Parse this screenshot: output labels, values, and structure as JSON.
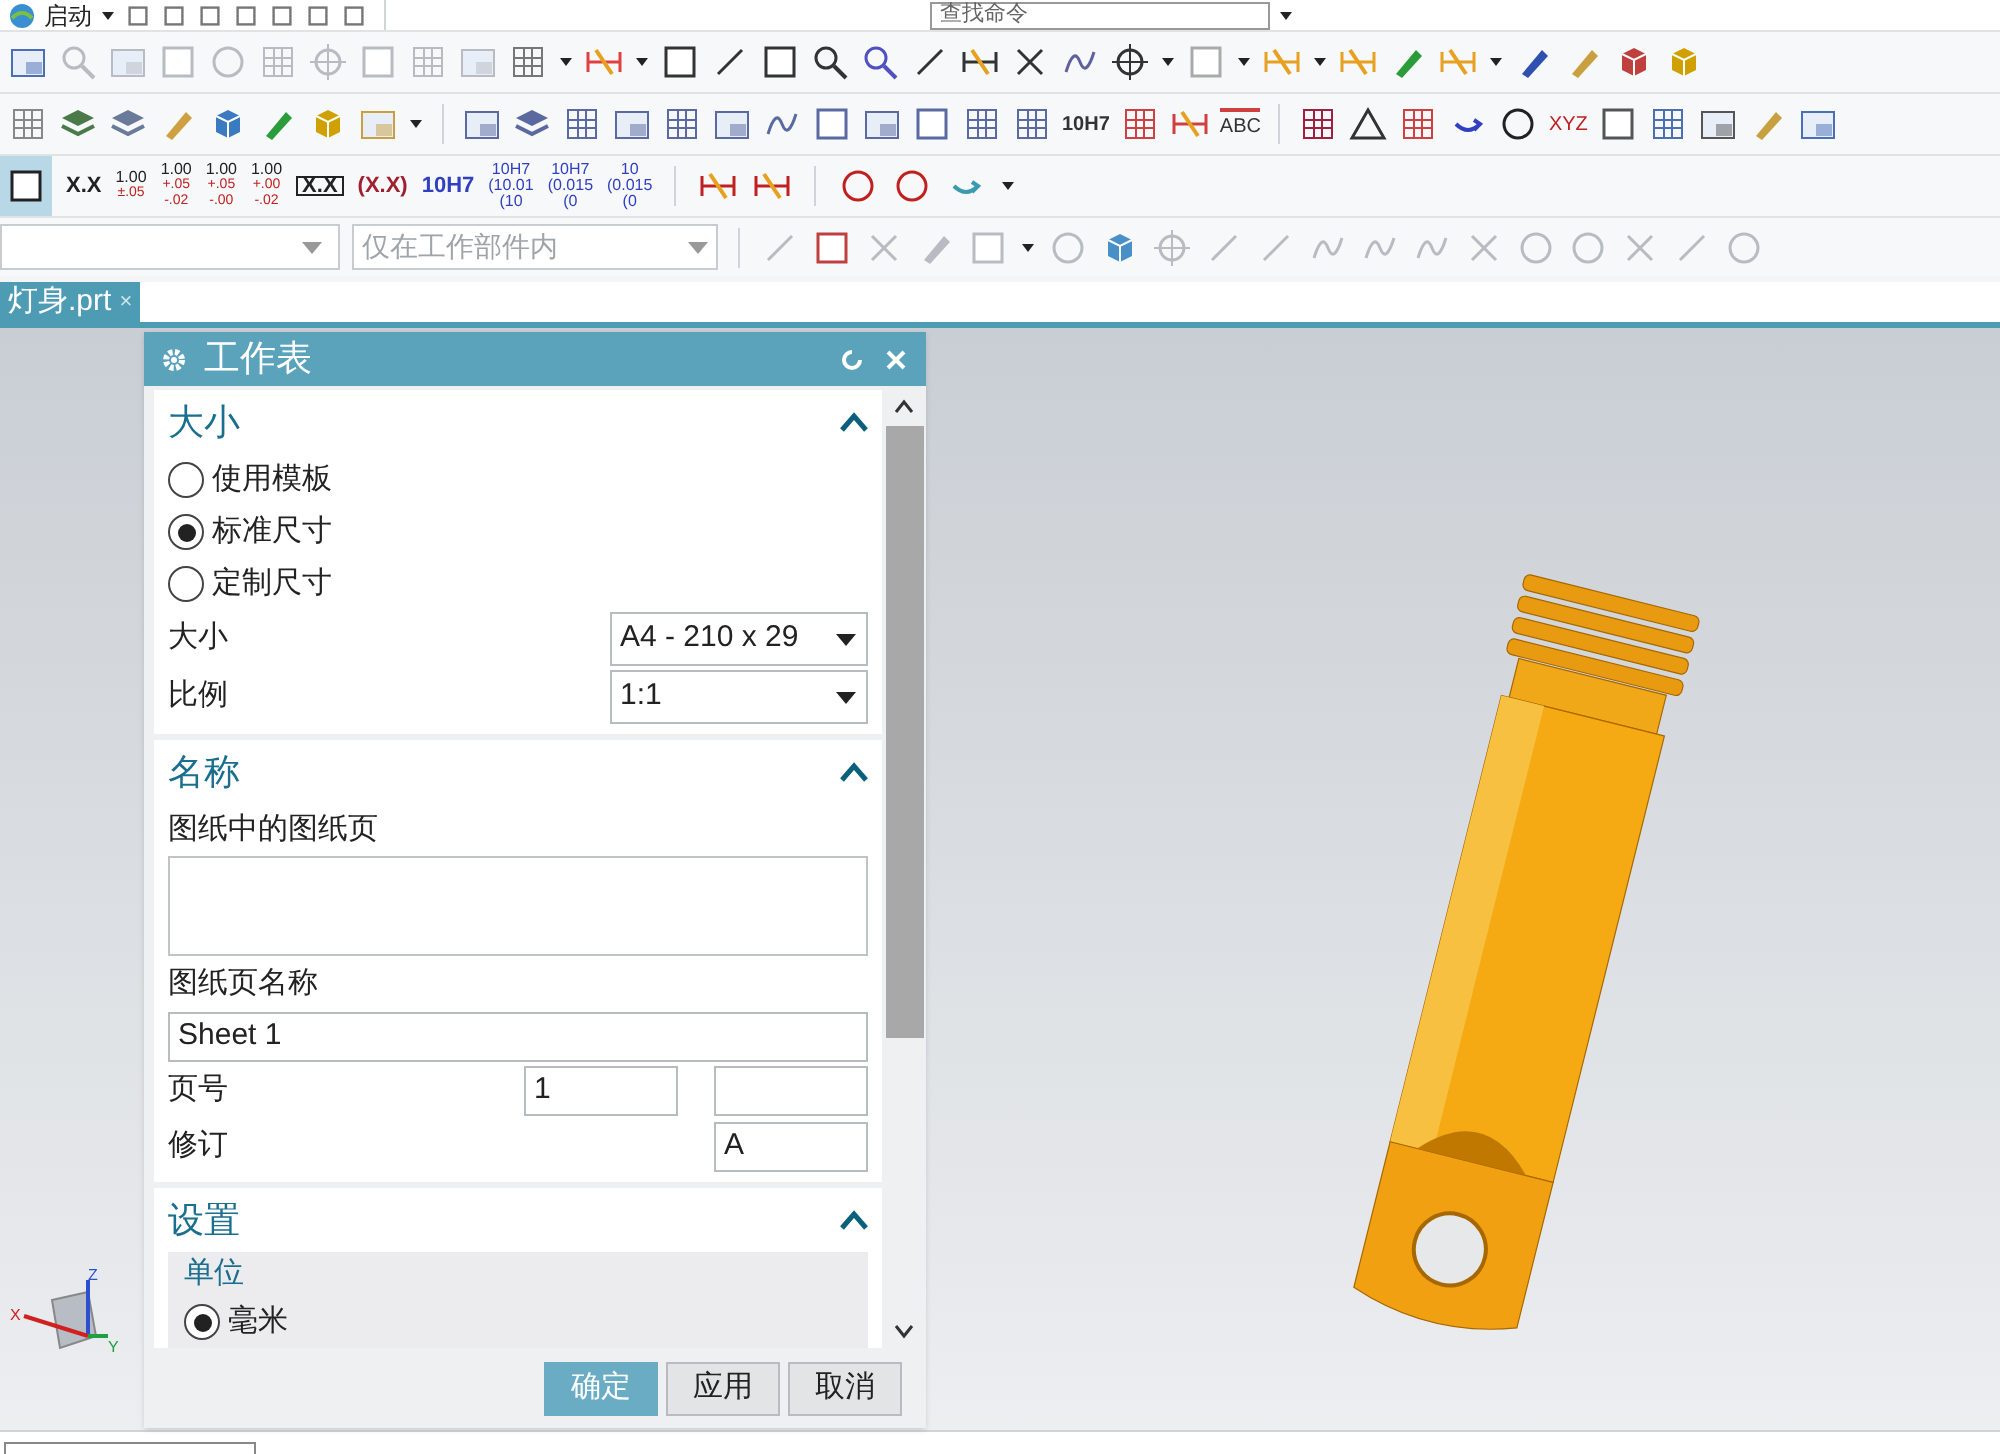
{
  "top_toolbar": {
    "start_menu": "启动",
    "search": {
      "placeholder": "查找命令"
    }
  },
  "annotation_toolbar": {
    "labels": [
      "10H7",
      "ABC",
      "XYZ"
    ]
  },
  "dimension_styles": [
    {
      "kind": "plain",
      "lines": [
        "X.X"
      ]
    },
    {
      "kind": "tolerance",
      "lines": [
        "1.00",
        "±.05"
      ]
    },
    {
      "kind": "tolerance",
      "lines": [
        "1.00",
        "+.05",
        "-.02"
      ]
    },
    {
      "kind": "tolerance",
      "lines": [
        "1.00",
        "+.05",
        "-.00"
      ]
    },
    {
      "kind": "tolerance",
      "lines": [
        "1.00",
        "+.00",
        "-.02"
      ]
    },
    {
      "kind": "boxed",
      "lines": [
        "X.X"
      ]
    },
    {
      "kind": "reference",
      "lines": [
        "(X.X)"
      ]
    },
    {
      "kind": "fit",
      "lines": [
        "10H7"
      ]
    },
    {
      "kind": "fit",
      "lines": [
        "10H7",
        "(10.01",
        "(10"
      ]
    },
    {
      "kind": "fit",
      "lines": [
        "10H7",
        "(0.015",
        "(0"
      ]
    },
    {
      "kind": "fit",
      "lines": [
        "10",
        "(0.015",
        "(0"
      ]
    }
  ],
  "selection_bar": {
    "scope": "仅在工作部件内"
  },
  "tabs": [
    {
      "label": "灯身.prt",
      "selected": true,
      "close": "×"
    }
  ],
  "dialog": {
    "title": "工作表",
    "size_section": {
      "title": "大小",
      "expanded": true,
      "options": [
        {
          "label": "使用模板",
          "selected": false
        },
        {
          "label": "标准尺寸",
          "selected": true
        },
        {
          "label": "定制尺寸",
          "selected": false
        }
      ],
      "size": {
        "label": "大小",
        "value": "A4 - 210 x 29"
      },
      "scale": {
        "label": "比例",
        "value": "1:1"
      }
    },
    "name_section": {
      "title": "名称",
      "expanded": true,
      "sheets_label": "图纸中的图纸页",
      "sheet_name_label": "图纸页名称",
      "sheet_name": "Sheet 1",
      "page_label": "页号",
      "page_number": "1",
      "revision_label": "修订",
      "revision": "A"
    },
    "settings_section": {
      "title": "设置",
      "expanded": true,
      "units_label": "单位",
      "units": [
        {
          "label": "毫米",
          "selected": true
        }
      ]
    },
    "buttons": [
      {
        "label": "确定",
        "primary": true
      },
      {
        "label": "应用",
        "primary": false
      },
      {
        "label": "取消",
        "primary": false
      }
    ]
  },
  "triad": {
    "x": "X",
    "y": "Y",
    "z": "Z"
  }
}
